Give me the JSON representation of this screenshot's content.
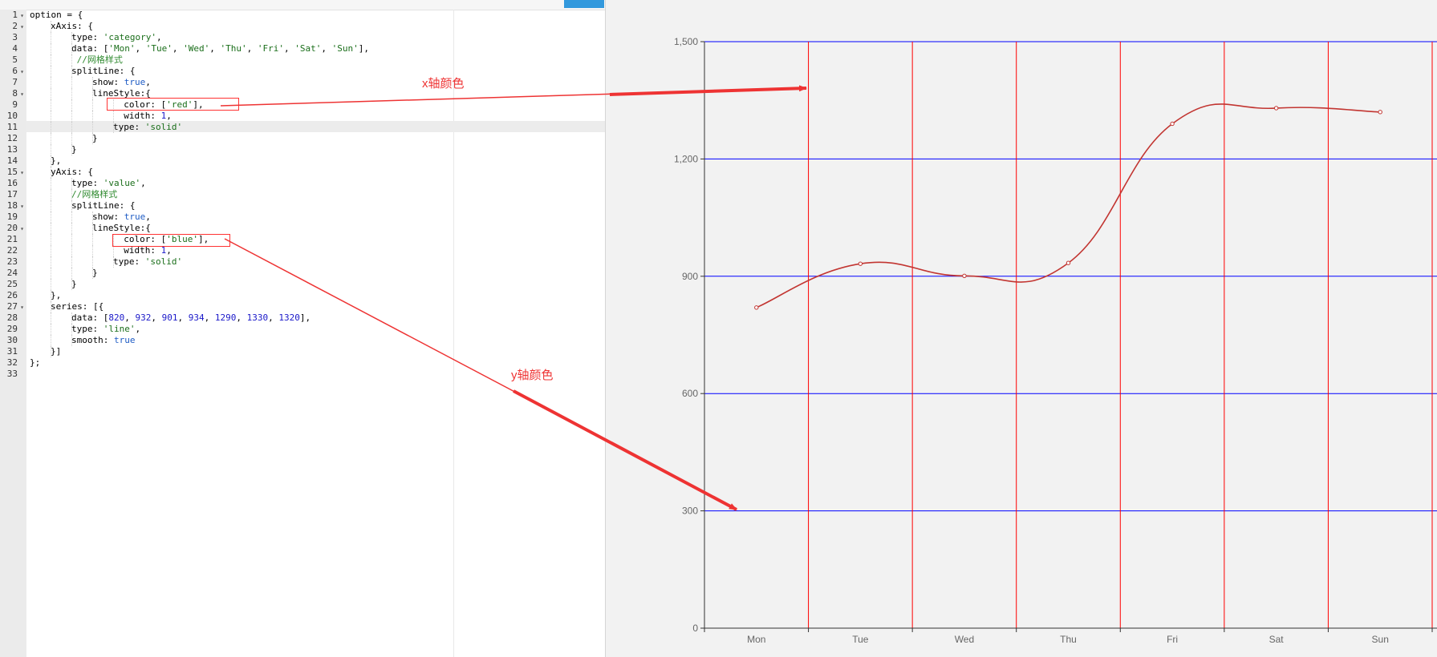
{
  "editor": {
    "lines": [
      {
        "n": "1",
        "fold": true,
        "indent": 0,
        "parts": [
          [
            "p",
            "option = {"
          ]
        ]
      },
      {
        "n": "2",
        "fold": true,
        "indent": 1,
        "parts": [
          [
            "p",
            "xAxis: {"
          ]
        ]
      },
      {
        "n": "3",
        "fold": false,
        "indent": 2,
        "parts": [
          [
            "p",
            "type: "
          ],
          [
            "s",
            "'category'"
          ],
          [
            "p",
            ","
          ]
        ]
      },
      {
        "n": "4",
        "fold": false,
        "indent": 2,
        "parts": [
          [
            "p",
            "data: ["
          ],
          [
            "s",
            "'Mon'"
          ],
          [
            "p",
            ", "
          ],
          [
            "s",
            "'Tue'"
          ],
          [
            "p",
            ", "
          ],
          [
            "s",
            "'Wed'"
          ],
          [
            "p",
            ", "
          ],
          [
            "s",
            "'Thu'"
          ],
          [
            "p",
            ", "
          ],
          [
            "s",
            "'Fri'"
          ],
          [
            "p",
            ", "
          ],
          [
            "s",
            "'Sat'"
          ],
          [
            "p",
            ", "
          ],
          [
            "s",
            "'Sun'"
          ],
          [
            "p",
            "],"
          ]
        ]
      },
      {
        "n": "5",
        "fold": false,
        "indent": 2,
        "parts": [
          [
            "c",
            " //网格样式"
          ]
        ]
      },
      {
        "n": "6",
        "fold": true,
        "indent": 2,
        "parts": [
          [
            "p",
            "splitLine: {"
          ]
        ]
      },
      {
        "n": "7",
        "fold": false,
        "indent": 3,
        "parts": [
          [
            "p",
            "show: "
          ],
          [
            "k",
            "true"
          ],
          [
            "p",
            ","
          ]
        ]
      },
      {
        "n": "8",
        "fold": true,
        "indent": 3,
        "parts": [
          [
            "p",
            "lineStyle:{"
          ]
        ]
      },
      {
        "n": "9",
        "fold": false,
        "indent": 4,
        "parts": [
          [
            "p",
            "  color: ["
          ],
          [
            "s",
            "'red'"
          ],
          [
            "p",
            "],"
          ]
        ]
      },
      {
        "n": "10",
        "fold": false,
        "indent": 4,
        "parts": [
          [
            "p",
            "  width: "
          ],
          [
            "n",
            "1"
          ],
          [
            "p",
            ","
          ]
        ]
      },
      {
        "n": "11",
        "fold": false,
        "indent": 4,
        "parts": [
          [
            "p",
            "type: "
          ],
          [
            "s",
            "'solid'"
          ]
        ]
      },
      {
        "n": "12",
        "fold": false,
        "indent": 3,
        "parts": [
          [
            "p",
            "}"
          ]
        ]
      },
      {
        "n": "13",
        "fold": false,
        "indent": 2,
        "parts": [
          [
            "p",
            "}"
          ]
        ]
      },
      {
        "n": "14",
        "fold": false,
        "indent": 1,
        "parts": [
          [
            "p",
            "},"
          ]
        ]
      },
      {
        "n": "15",
        "fold": true,
        "indent": 1,
        "parts": [
          [
            "p",
            "yAxis: {"
          ]
        ]
      },
      {
        "n": "16",
        "fold": false,
        "indent": 2,
        "parts": [
          [
            "p",
            "type: "
          ],
          [
            "s",
            "'value'"
          ],
          [
            "p",
            ","
          ]
        ]
      },
      {
        "n": "17",
        "fold": false,
        "indent": 2,
        "parts": [
          [
            "c",
            "//网格样式"
          ]
        ]
      },
      {
        "n": "18",
        "fold": true,
        "indent": 2,
        "parts": [
          [
            "p",
            "splitLine: {"
          ]
        ]
      },
      {
        "n": "19",
        "fold": false,
        "indent": 3,
        "parts": [
          [
            "p",
            "show: "
          ],
          [
            "k",
            "true"
          ],
          [
            "p",
            ","
          ]
        ]
      },
      {
        "n": "20",
        "fold": true,
        "indent": 3,
        "parts": [
          [
            "p",
            "lineStyle:{"
          ]
        ]
      },
      {
        "n": "21",
        "fold": false,
        "indent": 4,
        "parts": [
          [
            "p",
            "  color: ["
          ],
          [
            "s",
            "'blue'"
          ],
          [
            "p",
            "],"
          ]
        ]
      },
      {
        "n": "22",
        "fold": false,
        "indent": 4,
        "parts": [
          [
            "p",
            "  width: "
          ],
          [
            "n",
            "1"
          ],
          [
            "p",
            ","
          ]
        ]
      },
      {
        "n": "23",
        "fold": false,
        "indent": 4,
        "parts": [
          [
            "p",
            "type: "
          ],
          [
            "s",
            "'solid'"
          ]
        ]
      },
      {
        "n": "24",
        "fold": false,
        "indent": 3,
        "parts": [
          [
            "p",
            "}"
          ]
        ]
      },
      {
        "n": "25",
        "fold": false,
        "indent": 2,
        "parts": [
          [
            "p",
            "}"
          ]
        ]
      },
      {
        "n": "26",
        "fold": false,
        "indent": 1,
        "parts": [
          [
            "p",
            "},"
          ]
        ]
      },
      {
        "n": "27",
        "fold": true,
        "indent": 1,
        "parts": [
          [
            "p",
            "series: [{"
          ]
        ]
      },
      {
        "n": "28",
        "fold": false,
        "indent": 2,
        "parts": [
          [
            "p",
            "data: ["
          ],
          [
            "n",
            "820"
          ],
          [
            "p",
            ", "
          ],
          [
            "n",
            "932"
          ],
          [
            "p",
            ", "
          ],
          [
            "n",
            "901"
          ],
          [
            "p",
            ", "
          ],
          [
            "n",
            "934"
          ],
          [
            "p",
            ", "
          ],
          [
            "n",
            "1290"
          ],
          [
            "p",
            ", "
          ],
          [
            "n",
            "1330"
          ],
          [
            "p",
            ", "
          ],
          [
            "n",
            "1320"
          ],
          [
            "p",
            "],"
          ]
        ]
      },
      {
        "n": "29",
        "fold": false,
        "indent": 2,
        "parts": [
          [
            "p",
            "type: "
          ],
          [
            "s",
            "'line'"
          ],
          [
            "p",
            ","
          ]
        ]
      },
      {
        "n": "30",
        "fold": false,
        "indent": 2,
        "parts": [
          [
            "p",
            "smooth: "
          ],
          [
            "k",
            "true"
          ]
        ]
      },
      {
        "n": "31",
        "fold": false,
        "indent": 1,
        "parts": [
          [
            "p",
            "}]"
          ]
        ]
      },
      {
        "n": "32",
        "fold": false,
        "indent": 0,
        "parts": [
          [
            "p",
            "};"
          ]
        ]
      },
      {
        "n": "33",
        "fold": false,
        "indent": 0,
        "parts": []
      }
    ]
  },
  "annotations": {
    "x_label": "x轴颜色",
    "y_label": "y轴颜色",
    "color": "#ee3333"
  },
  "chart_data": {
    "type": "line",
    "smooth": true,
    "categories": [
      "Mon",
      "Tue",
      "Wed",
      "Thu",
      "Fri",
      "Sat",
      "Sun"
    ],
    "series": [
      {
        "values": [
          820,
          932,
          901,
          934,
          1290,
          1330,
          1320
        ],
        "color": "#c23531"
      }
    ],
    "ylim": [
      0,
      1500
    ],
    "yticks": [
      0,
      300,
      600,
      900,
      1200,
      1500
    ],
    "ytick_labels": [
      "0",
      "300",
      "600",
      "900",
      "1,200",
      "1,500"
    ],
    "x_grid_color": "#ff0000",
    "y_grid_color": "#0000ff",
    "grid": true,
    "title": "",
    "xlabel": "",
    "ylabel": ""
  }
}
